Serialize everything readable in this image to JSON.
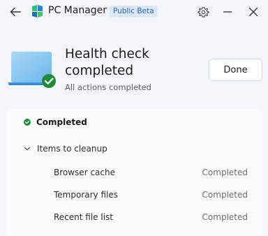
{
  "titlebar": {
    "app_name": "PC Manager",
    "badge": "Public Beta",
    "back_icon": "back-arrow-icon",
    "settings_icon": "gear-icon",
    "minimize_icon": "minimize-icon",
    "close_icon": "close-icon"
  },
  "header": {
    "title": "Health check completed",
    "subtitle": "All actions completed",
    "done_label": "Done",
    "illustration_icon": "laptop-check-icon"
  },
  "results": {
    "status": "Completed",
    "group_label": "Items to cleanup",
    "items": [
      {
        "label": "Browser cache",
        "status": "Completed"
      },
      {
        "label": "Temporary files",
        "status": "Completed"
      },
      {
        "label": "Recent file list",
        "status": "Completed"
      }
    ]
  },
  "colors": {
    "accent": "#2b62c2",
    "success": "#1f8b3a",
    "background": "#f2f5f9",
    "card": "#fafbfc"
  }
}
